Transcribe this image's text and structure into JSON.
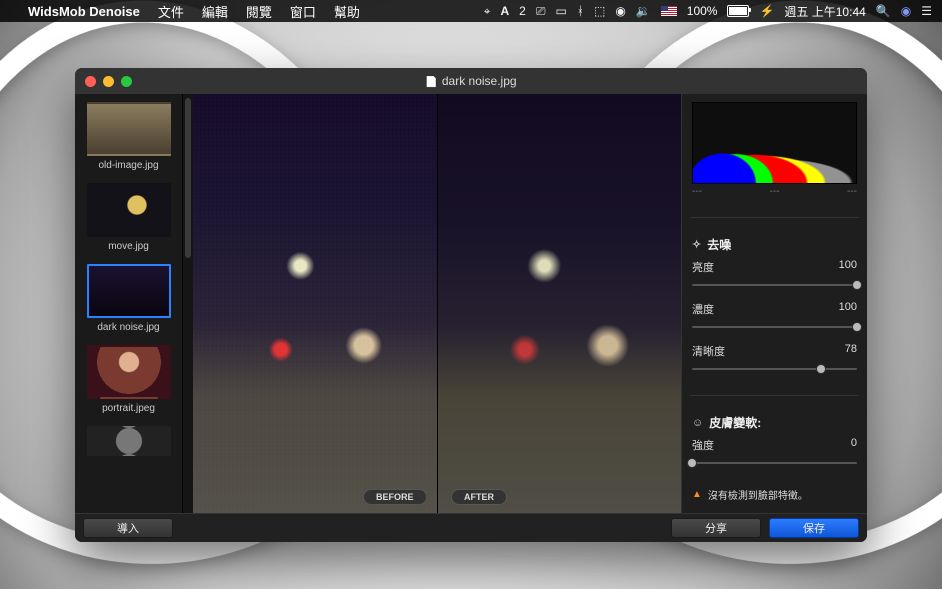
{
  "menubar": {
    "app_name": "WidsMob Denoise",
    "items": [
      "文件",
      "編輯",
      "閱覽",
      "窗口",
      "幫助"
    ],
    "battery_percent": "100%",
    "clock": "週五 上午10:44"
  },
  "window": {
    "title": "dark noise.jpg",
    "footer": {
      "import": "導入",
      "share": "分享",
      "save": "保存"
    }
  },
  "thumbs": [
    {
      "label": "old-image.jpg",
      "cls": "timg-old",
      "selected": false
    },
    {
      "label": "move.jpg",
      "cls": "timg-move",
      "selected": false
    },
    {
      "label": "dark noise.jpg",
      "cls": "timg-dark",
      "selected": true
    },
    {
      "label": "portrait.jpeg",
      "cls": "timg-portrait",
      "selected": false
    },
    {
      "label": "",
      "cls": "timg-extra",
      "selected": false
    }
  ],
  "preview": {
    "before_label": "BEFORE",
    "after_label": "AFTER"
  },
  "histogram": {
    "vals": [
      "---",
      "---",
      "---"
    ]
  },
  "sections": {
    "denoise": {
      "title": "去噪",
      "controls": [
        {
          "label": "亮度",
          "value": 100,
          "max": 100
        },
        {
          "label": "濃度",
          "value": 100,
          "max": 100
        },
        {
          "label": "清晰度",
          "value": 78,
          "max": 100
        }
      ]
    },
    "skin": {
      "title": "皮膚變軟:",
      "controls": [
        {
          "label": "強度",
          "value": 0,
          "max": 100
        }
      ],
      "warning": "沒有檢測到臉部特徵。"
    }
  }
}
